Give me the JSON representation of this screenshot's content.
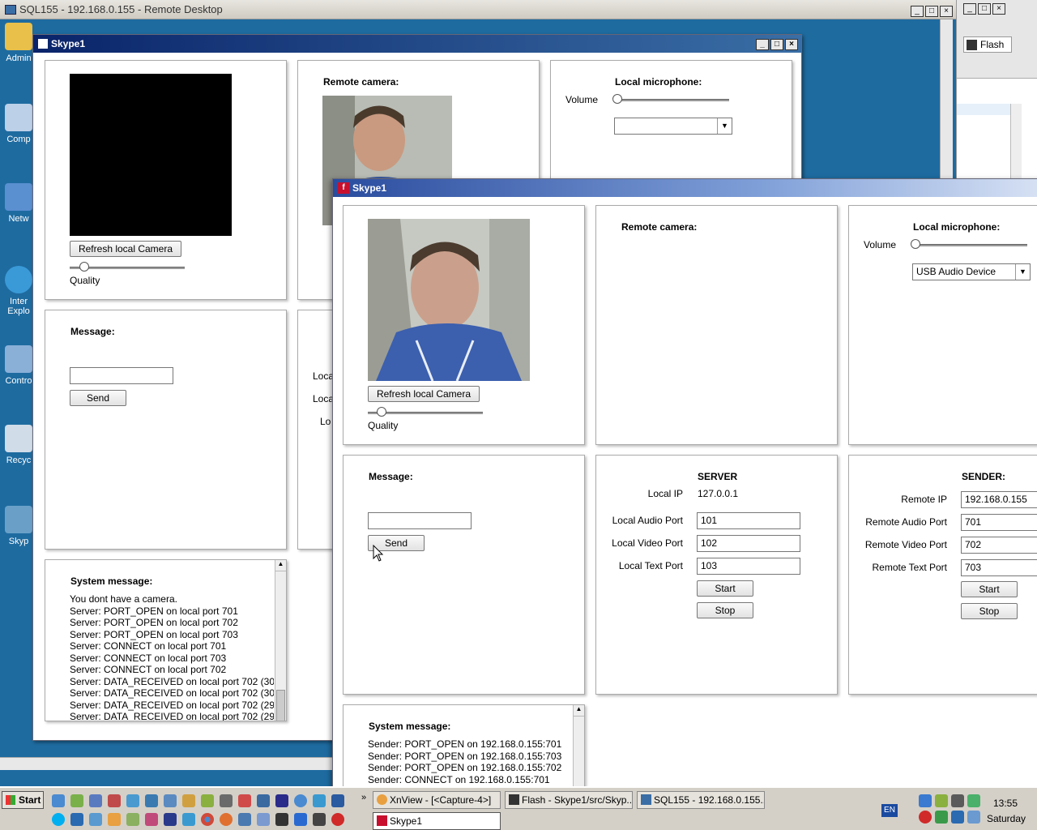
{
  "remote_desktop": {
    "title": "SQL155 - 192.168.0.155 - Remote Desktop",
    "desktop_icons": [
      "Admin",
      "Comp",
      "Netw",
      "Inter Explo",
      "Contro",
      "Recyc",
      "Skyp"
    ]
  },
  "back_window": {
    "title": "Skype1",
    "remote_camera_label": "Remote camera:",
    "local_mic_label": "Local microphone:",
    "volume_label": "Volume",
    "mic_select_value": "",
    "refresh_button": "Refresh local Camera",
    "quality_label": "Quality",
    "message_label": "Message:",
    "message_value": "",
    "send_button": "Send",
    "partial_labels": [
      "Loca",
      "Loca",
      "Lo"
    ],
    "system_message_label": "System message:",
    "log": [
      "You dont have a camera.",
      "Server: PORT_OPEN on local port 701",
      "Server: PORT_OPEN on local port 702",
      "Server: PORT_OPEN on local port 703",
      "Server: CONNECT on local port 701",
      "Server: CONNECT on local port 703",
      "Server: CONNECT on local port 702",
      "Server: DATA_RECEIVED on local port 702 (30",
      "Server: DATA_RECEIVED on local port 702 (30",
      "Server: DATA_RECEIVED on local port 702 (29",
      "Server: DATA_RECEIVED on local port 702 (29"
    ]
  },
  "front_window": {
    "title": "Skype1",
    "refresh_button": "Refresh local Camera",
    "quality_label": "Quality",
    "quality_level": 0.12,
    "remote_camera_label": "Remote camera:",
    "local_mic_label": "Local microphone:",
    "volume_label": "Volume",
    "volume_level": 0.0,
    "mic_select_value": "USB Audio Device",
    "message_label": "Message:",
    "message_value": "",
    "send_button": "Send",
    "server": {
      "heading": "SERVER",
      "local_ip_label": "Local IP",
      "local_ip_value": "127.0.0.1",
      "audio_port_label": "Local Audio Port",
      "audio_port_value": "101",
      "video_port_label": "Local Video Port",
      "video_port_value": "102",
      "text_port_label": "Local Text Port",
      "text_port_value": "103",
      "start_button": "Start",
      "stop_button": "Stop"
    },
    "sender": {
      "heading": "SENDER:",
      "remote_ip_label": "Remote IP",
      "remote_ip_value": "192.168.0.155",
      "audio_port_label": "Remote Audio Port",
      "audio_port_value": "701",
      "video_port_label": "Remote Video Port",
      "video_port_value": "702",
      "text_port_label": "Remote Text Port",
      "text_port_value": "703",
      "start_button": "Start",
      "stop_button": "Stop"
    },
    "system_message_label": "System message:",
    "log": [
      "Sender: PORT_OPEN on 192.168.0.155:701",
      "Sender: PORT_OPEN on 192.168.0.155:703",
      "Sender: PORT_OPEN on 192.168.0.155:702",
      "Sender: CONNECT on 192.168.0.155:701"
    ]
  },
  "right_window": {
    "tab_label": "Flash"
  },
  "taskbar": {
    "start_label": "Start",
    "tasks": [
      {
        "label": "XnView - [<Capture-4>]"
      },
      {
        "label": "Flash - Skype1/src/Skyp..."
      },
      {
        "label": "SQL155 - 192.168.0.155..."
      },
      {
        "label": "Skype1"
      }
    ],
    "language": "EN",
    "clock": "13:55",
    "day": "Saturday"
  },
  "colors": {
    "desktop": "#1e6ba0",
    "titlebar_dark": "#0a246a",
    "flash_red": "#c8102e"
  }
}
